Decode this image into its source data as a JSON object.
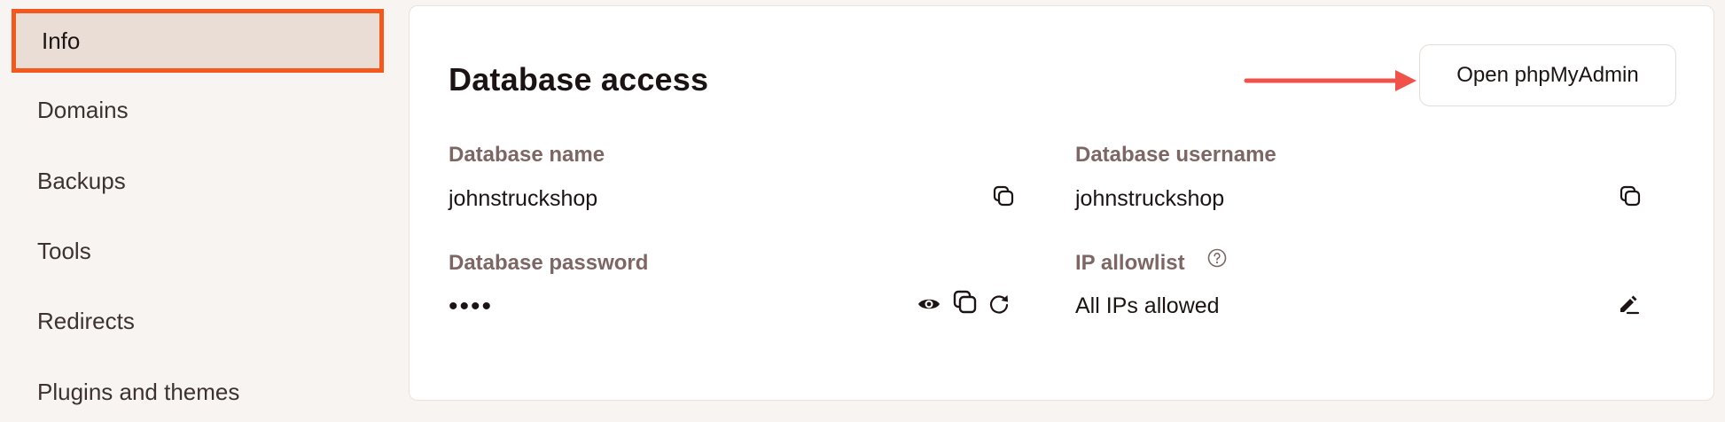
{
  "sidebar": {
    "items": [
      {
        "label": "Info",
        "active": true
      },
      {
        "label": "Domains"
      },
      {
        "label": "Backups"
      },
      {
        "label": "Tools"
      },
      {
        "label": "Redirects"
      },
      {
        "label": "Plugins and themes"
      }
    ]
  },
  "card": {
    "title": "Database access",
    "open_button_label": "Open phpMyAdmin",
    "fields": {
      "db_name": {
        "label": "Database name",
        "value": "johnstruckshop"
      },
      "db_username": {
        "label": "Database username",
        "value": "johnstruckshop"
      },
      "db_password": {
        "label": "Database password",
        "value": "••••"
      },
      "ip_allowlist": {
        "label": "IP allowlist",
        "value": "All IPs allowed"
      }
    }
  },
  "colors": {
    "accent_border": "#f4581c",
    "arrow": "#f0524a",
    "label": "#7d6765",
    "active_bg": "#eaddd6"
  },
  "icons": [
    "copy-icon",
    "eye-icon",
    "refresh-icon",
    "help-icon",
    "edit-icon"
  ]
}
